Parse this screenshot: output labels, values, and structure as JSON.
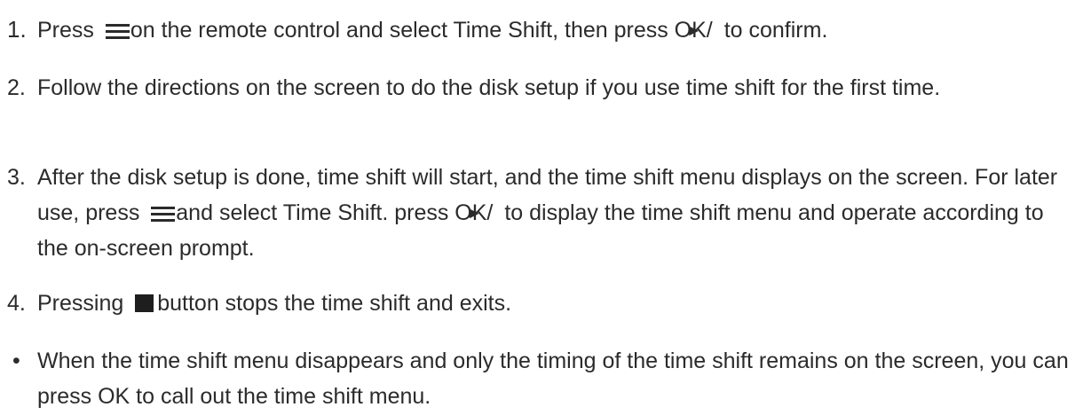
{
  "steps": [
    {
      "number": "1.",
      "part1": "Press ",
      "icon1": "menu-icon",
      "part2": "on the remote control and select Time Shift, then press OK/",
      "icon2": "play-icon",
      "part3": " to confirm."
    },
    {
      "number": "2.",
      "text": "Follow the directions on the screen to do the disk setup if you use time shift for the first time."
    },
    {
      "number": "3.",
      "part1": "After the disk setup is done, time shift will start, and the time shift menu displays on the screen. For later use, press ",
      "icon1": "menu-icon",
      "part2": "and select Time Shift. press OK/",
      "icon2": "play-icon",
      "part3": " to display the time shift menu and operate according to the on-screen prompt."
    },
    {
      "number": "4.",
      "part1": "Pressing ",
      "icon1": "stop-icon",
      "part2": "button stops the time shift and exits."
    }
  ],
  "note": {
    "bullet": "•",
    "text": "When the time shift menu disappears and only the timing of the time shift remains on the screen, you can press OK to call out the time shift menu."
  },
  "glyphs": {
    "play": "►"
  }
}
